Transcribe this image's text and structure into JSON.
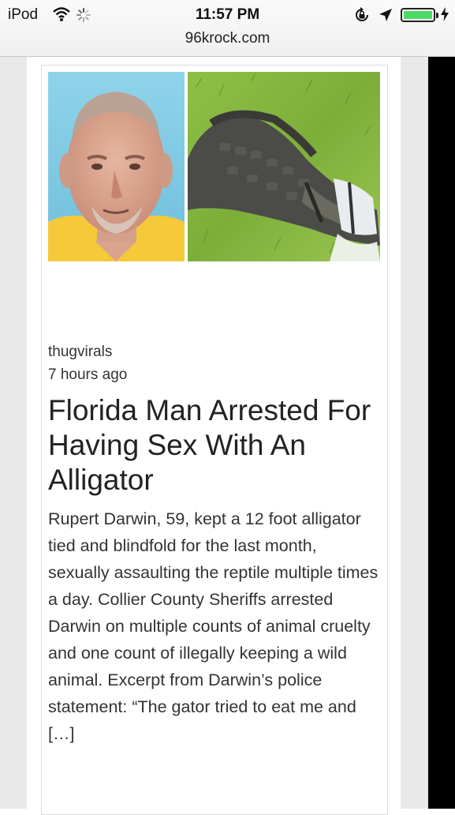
{
  "status_bar": {
    "carrier": "iPod",
    "time": "11:57 PM",
    "battery_level": 1.0
  },
  "browser": {
    "url": "96krock.com"
  },
  "article": {
    "author": "thugvirals",
    "time_ago": "7 hours ago",
    "title": "Florida Man Arrested For Having Sex With An Alligator",
    "excerpt": "Rupert Darwin, 59, kept a 12 foot alligator tied and blindfold for the last month, sexually assaulting the reptile multiple times a day. Collier County Sheriffs arrested Darwin on multiple counts of animal cruelty and one count of illegally keeping a wild animal. Excerpt from Darwin’s police statement: “The gator tried to eat me and […]"
  },
  "icons": {
    "wifi": "wifi-icon",
    "activity": "spinner-icon",
    "rotation_lock": "rotation-lock-icon",
    "location": "location-arrow-icon",
    "battery": "battery-icon",
    "charging": "charging-bolt-icon"
  },
  "colors": {
    "battery": "#4cd964",
    "page_bg": "#e9e9e9",
    "text": "#222222"
  }
}
